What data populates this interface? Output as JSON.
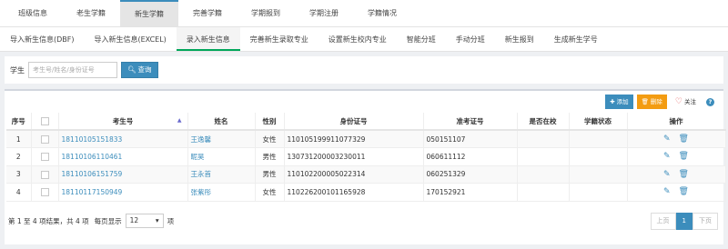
{
  "top_tabs": [
    "班级信息",
    "老生学籍",
    "新生学籍",
    "完善学籍",
    "学期报到",
    "学期注册",
    "学籍情况"
  ],
  "sub_tabs": [
    "导入新生信息(DBF)",
    "导入新生信息(EXCEL)",
    "录入新生信息",
    "完善新生录取专业",
    "设置新生校内专业",
    "智能分班",
    "手动分班",
    "新生报到",
    "生成新生学号"
  ],
  "filter": {
    "label": "学生",
    "placeholder": "考生号/姓名/身份证号",
    "search_label": "查询"
  },
  "toolbar": {
    "add_label": "添加",
    "delete_label": "删除",
    "follow_label": "关注",
    "help_label": "?"
  },
  "table": {
    "headers": [
      "序号",
      "",
      "考生号",
      "姓名",
      "性别",
      "身份证号",
      "准考证号",
      "是否在校",
      "学籍状态",
      "操作"
    ],
    "rows": [
      {
        "no": "1",
        "exam_no": "18110105151833",
        "name": "王逸馨",
        "gender": "女性",
        "id_no": "110105199911077329",
        "ticket": "050151107",
        "in_school": "",
        "status": ""
      },
      {
        "no": "2",
        "exam_no": "18110106110461",
        "name": "昵昊",
        "gender": "男性",
        "id_no": "130731200003230011",
        "ticket": "060611112",
        "in_school": "",
        "status": ""
      },
      {
        "no": "3",
        "exam_no": "18110106151759",
        "name": "王永首",
        "gender": "男性",
        "id_no": "110102200005022314",
        "ticket": "060251329",
        "in_school": "",
        "status": ""
      },
      {
        "no": "4",
        "exam_no": "18110117150949",
        "name": "张紫彤",
        "gender": "女性",
        "id_no": "110226200101165928",
        "ticket": "170152921",
        "in_school": "",
        "status": ""
      }
    ]
  },
  "footer": {
    "summary": "第 1 至 4 项结果，共 4 项",
    "per_page_label": "每页显示",
    "page_size": "12",
    "unit": "项",
    "prev": "上页",
    "current": "1",
    "next": "下页"
  }
}
